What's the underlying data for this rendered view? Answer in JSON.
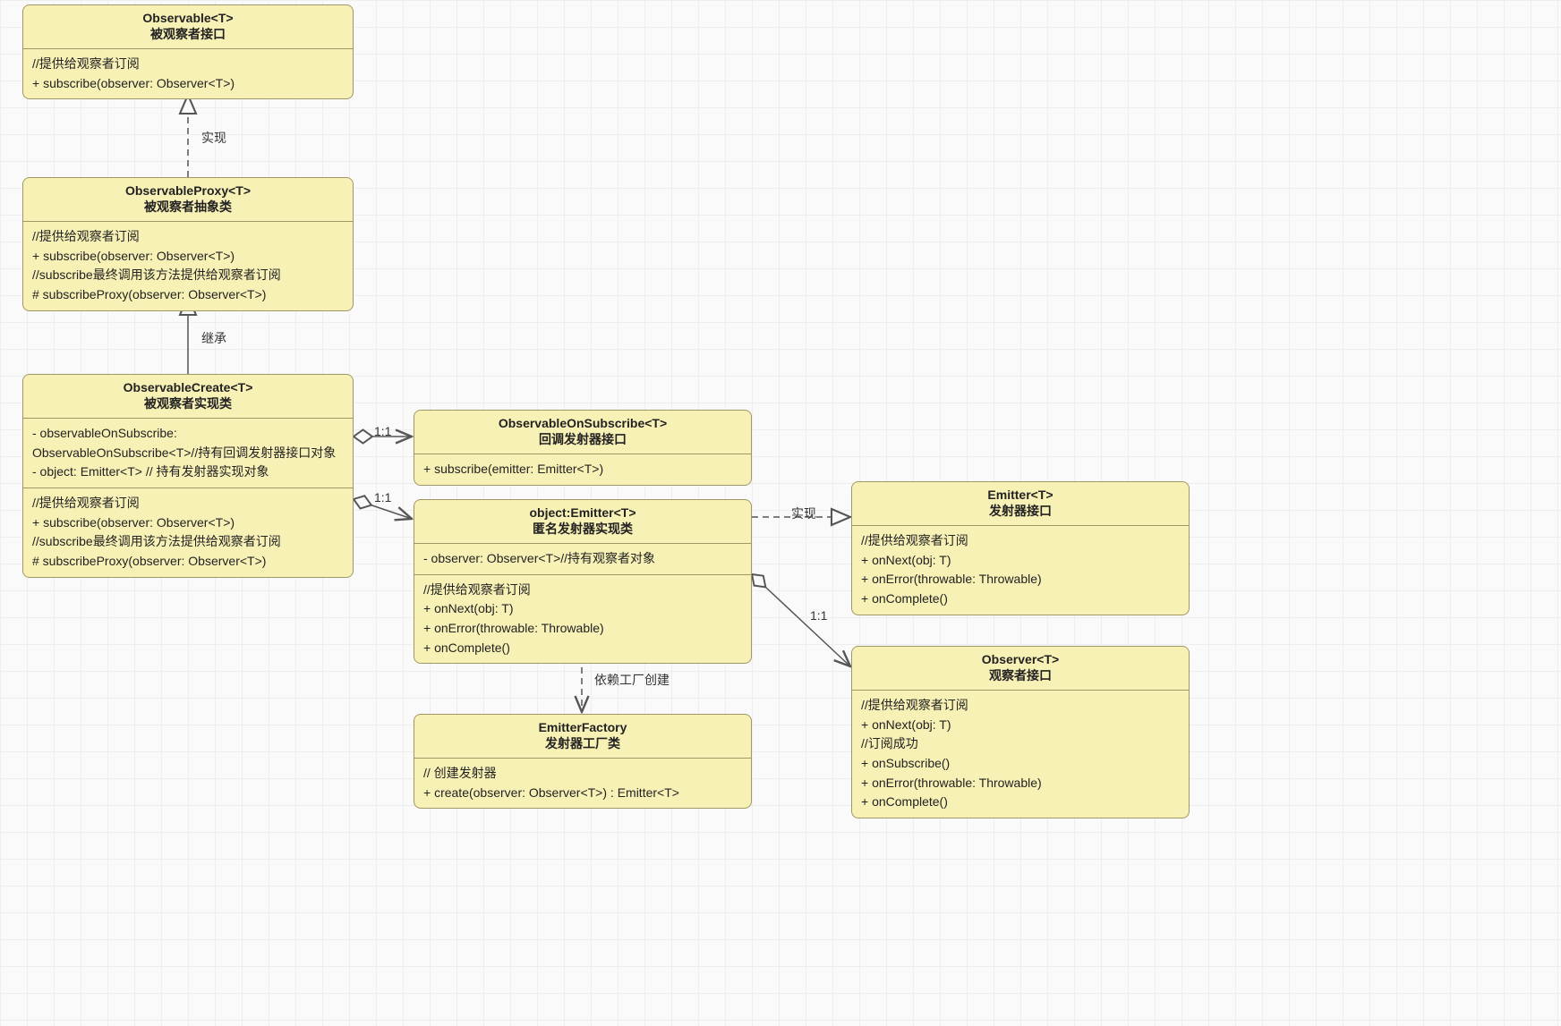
{
  "colors": {
    "box_fill": "#f8f1b6",
    "box_border": "#a19665"
  },
  "edges": {
    "realize1": "实现",
    "inherit1": "继承",
    "assoc_obsOnSub": "1:1",
    "assoc_objEmitter": "1:1",
    "realize_emitter": "实现",
    "assoc_observer": "1:1",
    "dep_factory": "依赖工厂创建"
  },
  "boxes": {
    "observable": {
      "title": "Observable<T>",
      "subtitle": "被观察者接口",
      "rows": [
        "//提供给观察者订阅",
        "+ subscribe(observer: Observer<T>)"
      ]
    },
    "observableProxy": {
      "title": "ObservableProxy<T>",
      "subtitle": "被观察者抽象类",
      "rows": [
        "//提供给观察者订阅",
        "+ subscribe(observer: Observer<T>)",
        "//subscribe最终调用该方法提供给观察者订阅",
        "# subscribeProxy(observer: Observer<T>)"
      ]
    },
    "observableCreate": {
      "title": "ObservableCreate<T>",
      "subtitle": "被观察者实现类",
      "section1": [
        "- observableOnSubscribe: ObservableOnSubscribe<T>//持有回调发射器接口对象",
        "- object: Emitter<T> // 持有发射器实现对象"
      ],
      "section2": [
        "//提供给观察者订阅",
        "+ subscribe(observer: Observer<T>)",
        "//subscribe最终调用该方法提供给观察者订阅",
        "# subscribeProxy(observer: Observer<T>)"
      ]
    },
    "observableOnSubscribe": {
      "title": "ObservableOnSubscribe<T>",
      "subtitle": "回调发射器接口",
      "rows": [
        "+ subscribe(emitter: Emitter<T>)"
      ]
    },
    "objectEmitter": {
      "title": "object:Emitter<T>",
      "subtitle": "匿名发射器实现类",
      "section1": [
        "- observer: Observer<T>//持有观察者对象"
      ],
      "section2": [
        "//提供给观察者订阅",
        "+ onNext(obj: T)",
        "+ onError(throwable: Throwable)",
        "+ onComplete()"
      ]
    },
    "emitter": {
      "title": "Emitter<T>",
      "subtitle": "发射器接口",
      "rows": [
        "//提供给观察者订阅",
        "+ onNext(obj: T)",
        "+ onError(throwable: Throwable)",
        "+ onComplete()"
      ]
    },
    "observer": {
      "title": "Observer<T>",
      "subtitle": "观察者接口",
      "rows": [
        "//提供给观察者订阅",
        "+ onNext(obj: T)",
        "//订阅成功",
        "+ onSubscribe()",
        "+ onError(throwable: Throwable)",
        "+ onComplete()"
      ]
    },
    "emitterFactory": {
      "title": "EmitterFactory",
      "subtitle": "发射器工厂类",
      "rows": [
        "// 创建发射器",
        "+ create(observer: Observer<T>) : Emitter<T>"
      ]
    }
  }
}
